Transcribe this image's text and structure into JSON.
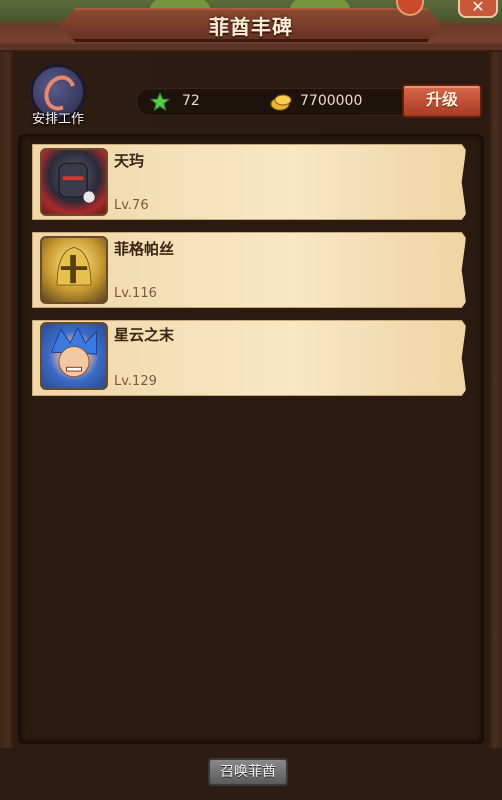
{
  "window": {
    "title": "菲酋丰碑"
  },
  "controls": {
    "close_symbol": "✕"
  },
  "worker": {
    "label": "安排工作"
  },
  "resources": {
    "exp": {
      "icon": "exp-star-icon",
      "value": "72"
    },
    "gold": {
      "icon": "gold-coin-icon",
      "value": "7700000"
    }
  },
  "upgrade": {
    "label": "升级"
  },
  "heroes": [
    {
      "name": "天玙",
      "level": "Lv.76",
      "portrait": "armored-knight-portrait"
    },
    {
      "name": "菲格帕丝",
      "level": "Lv.116",
      "portrait": "golden-helmet-portrait"
    },
    {
      "name": "星云之末",
      "level": "Lv.129",
      "portrait": "blue-hair-warrior-portrait"
    }
  ],
  "summon": {
    "label": "召唤菲酋"
  },
  "colors": {
    "accent": "#c8583a",
    "panel": "#2a1a10",
    "card": "#f4dcb2"
  }
}
